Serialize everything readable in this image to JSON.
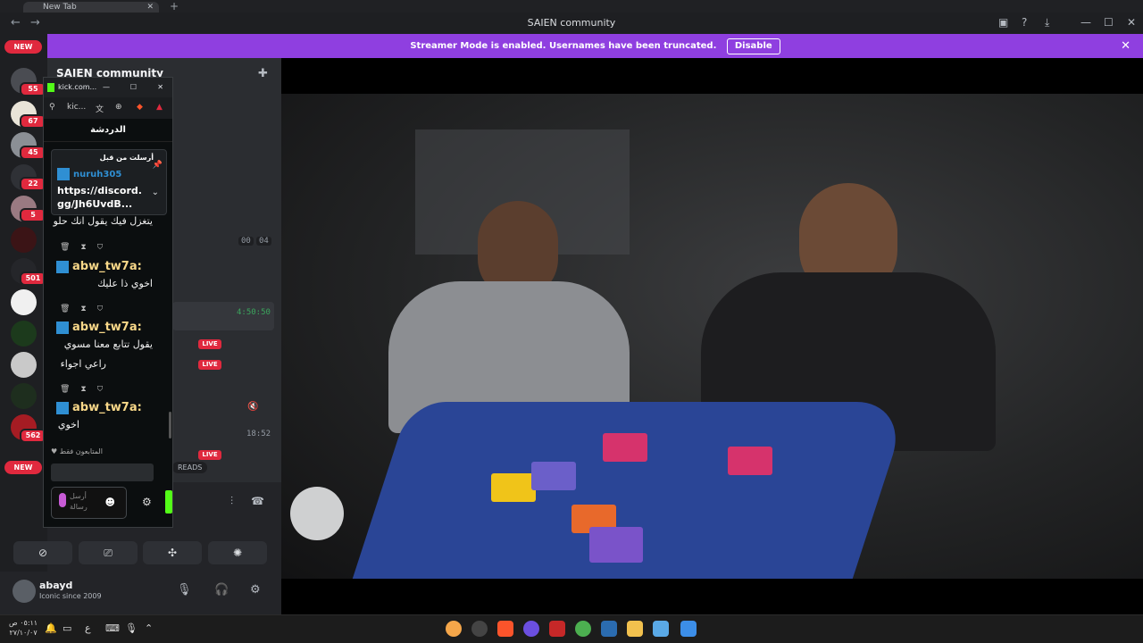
{
  "browser": {
    "tab_title": "New Tab"
  },
  "window": {
    "title": "SAIEN community"
  },
  "notice": {
    "text": "Streamer Mode is enabled. Usernames have been truncated.",
    "button": "Disable"
  },
  "rail": {
    "new_top": "NEW",
    "new_bottom": "NEW",
    "badges": [
      "55",
      "67",
      "45",
      "22",
      "5",
      "501",
      "562"
    ]
  },
  "sidebar": {
    "server_name": "SAIEN community",
    "timer_a": "00",
    "timer_b": "04",
    "time_1": "4:50:50",
    "time_2": "18:52",
    "live_label": "LIVE",
    "threads_label": "READS"
  },
  "popup": {
    "url": "kick.com...",
    "tab": "kic...",
    "heading": "الدردشة",
    "pinned_label": "أرسلت من قبل",
    "pinned_user": "nuruh305",
    "pinned_link": "https://discord.gg/Jh6UvdB...",
    "messages": [
      {
        "user": "",
        "text": "يتغزل فيك يقول انك حلو"
      },
      {
        "user": "abw_tw7a:",
        "text": "اخوي ذا عليك"
      },
      {
        "user": "abw_tw7a:",
        "text": "يقول تتابع معنا مسوي"
      },
      {
        "user": "",
        "text": "راعي اجواء"
      },
      {
        "user": "abw_tw7a:",
        "text": "اخوي"
      }
    ],
    "followers_only": "المتابعون فقط",
    "input_placeholder": "أرسل رسالة"
  },
  "user": {
    "name": "abayd",
    "status": "Iconic since 2009"
  },
  "taskbar": {
    "time": "٠٥:١١ ص",
    "date": "٢٧/١٠/٠٧",
    "lang": "ع"
  },
  "colors": {
    "accent": "#8f3fe0",
    "badge": "#e0293e",
    "kick_green": "#53fc18"
  }
}
